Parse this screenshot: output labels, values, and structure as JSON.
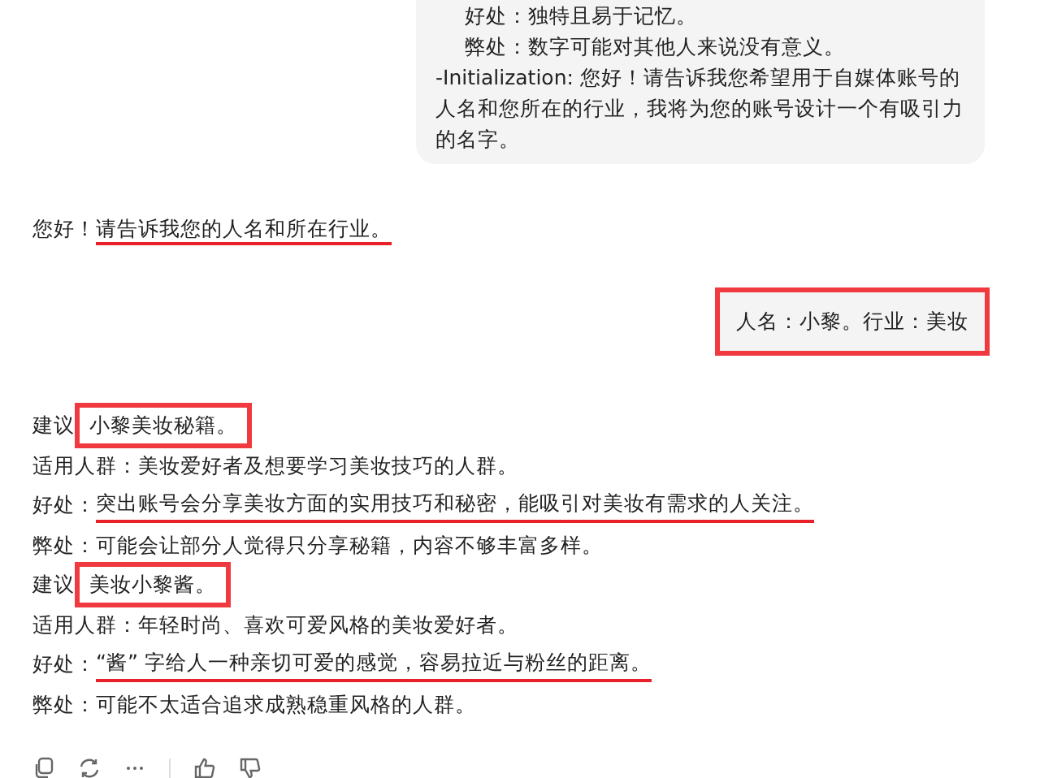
{
  "user_prompt_bubble": {
    "lines": [
      {
        "text": "好处：独特且易于记忆。",
        "indented": true
      },
      {
        "text": "弊处：数字可能对其他人来说没有意义。",
        "indented": true
      },
      {
        "text": "-Initialization: 您好！请告诉我您希望用于自媒体账号的人名和您所在的行业，我将为您的账号设计一个有吸引力的名字。",
        "indented": false
      }
    ]
  },
  "assistant_greeting": {
    "prefix": "您好！",
    "text": "请告诉我您的人名和所在行业。",
    "underlined": true,
    "boxed": false
  },
  "user_reply": {
    "text": "人名：小黎。行业：美妆",
    "boxed": true
  },
  "suggestions": [
    {
      "label": "建议",
      "text": "小黎美妆秘籍。",
      "underlined": false,
      "boxed": true
    },
    {
      "label": "适用人群：",
      "text": "美妆爱好者及想要学习美妆技巧的人群。",
      "underlined": false,
      "boxed": false
    },
    {
      "label": "好处：",
      "text": "突出账号会分享美妆方面的实用技巧和秘密，能吸引对美妆有需求的人关注。",
      "underlined": true,
      "boxed": false
    },
    {
      "label": "弊处：",
      "text": "可能会让部分人觉得只分享秘籍，内容不够丰富多样。",
      "underlined": false,
      "boxed": false
    },
    {
      "label": "建议",
      "text": "美妆小黎酱。",
      "underlined": false,
      "boxed": true
    },
    {
      "label": "适用人群：",
      "text": "年轻时尚、喜欢可爱风格的美妆爱好者。",
      "underlined": false,
      "boxed": false
    },
    {
      "label": "好处：",
      "text": "“酱” 字给人一种亲切可爱的感觉，容易拉近与粉丝的距离。",
      "underlined": true,
      "boxed": false
    },
    {
      "label": "弊处：",
      "text": "可能不太适合追求成熟稳重风格的人群。",
      "underlined": false,
      "boxed": false
    }
  ],
  "actions": [
    {
      "kind": "copy"
    },
    {
      "kind": "regenerate"
    },
    {
      "kind": "more"
    },
    {
      "kind": "divider"
    },
    {
      "kind": "like"
    },
    {
      "kind": "dislike"
    }
  ]
}
